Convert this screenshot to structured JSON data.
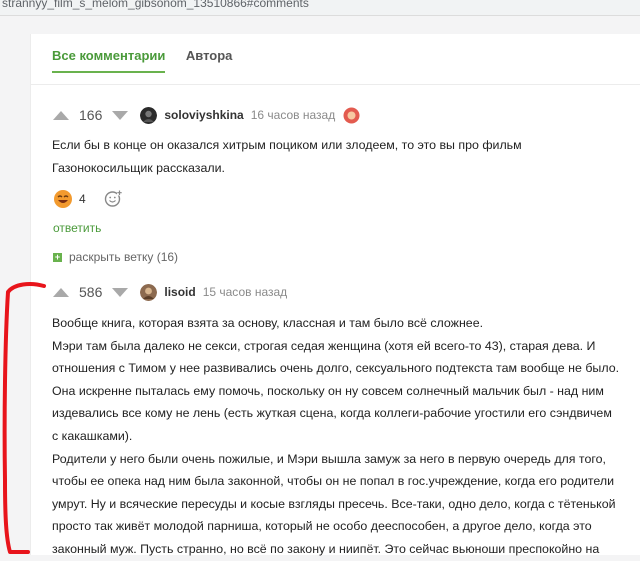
{
  "browser": {
    "url": "strannyy_film_s_melom_gibsonom_13510866#comments"
  },
  "tabs": [
    {
      "label": "Все комментарии",
      "active": true
    },
    {
      "label": "Автора",
      "active": false
    }
  ],
  "comments": [
    {
      "rating": "166",
      "username": "soloviyshkina",
      "time": "16 часов назад",
      "text": [
        "Если бы в конце он оказался хитрым поциком или злодеем, то это вы про фильм",
        "Газонокосильщик рассказали."
      ],
      "reaction_count": "4",
      "reply_label": "ответить",
      "expand_label": "раскрыть ветку (16)"
    },
    {
      "rating": "586",
      "username": "lisoid",
      "time": "15 часов назад",
      "text": [
        "Вообще книга, которая взята за основу, классная и там было всё сложнее.",
        "Мэри там была далеко не секси, строгая седая женщина (хотя ей всего-то 43), старая дева. И",
        "отношения с Тимом у нее развивались очень долго, сексуального подтекста там вообще не было.",
        "Она искренне пыталась ему помочь, поскольку он ну совсем солнечный мальчик был - над ним",
        "издевались все кому не лень (есть жуткая сцена, когда коллеги-рабочие угостили его сэндвичем",
        "с какашками).",
        "Родители у него были очень пожилые, и Мэри вышла замуж за него в первую очередь для того,",
        "чтобы ее опека над ним была законной, чтобы он не попал в гос.учреждение, когда его родители",
        "умрут. Ну и всяческие пересуды и косые взгляды пресечь. Все-таки, одно дело, когда с тётенькой",
        "просто так живёт молодой парниша, который не особо дееспособен, а другое дело, когда это",
        "законный муж. Пусть странно, но всё по закону и ниипёт. Это сейчас вьюноши преспокойно на"
      ]
    }
  ],
  "colors": {
    "accent": "#69b24d",
    "annotation": "#e8141b"
  }
}
